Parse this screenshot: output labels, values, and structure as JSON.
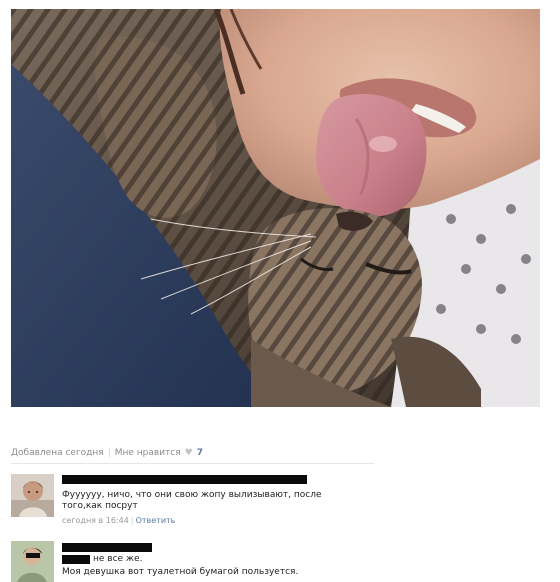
{
  "post": {
    "added_label": "Добавлена сегодня",
    "like_label": "Мне нравится",
    "like_count": "7"
  },
  "comments": [
    {
      "text": "Фуууууу, ничо, что они свою жопу вылизывают, после того,как посрут",
      "time": "сегодня в 16:44",
      "reply_label": "Ответить"
    },
    {
      "name_tail": "не все же.",
      "text": "Моя девушка вот туалетной бумагой пользуется."
    }
  ]
}
